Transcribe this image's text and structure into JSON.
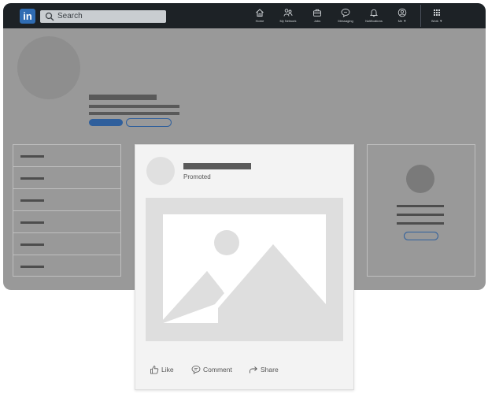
{
  "header": {
    "logo_text": "in",
    "search": {
      "placeholder": "Search"
    },
    "nav": [
      {
        "label": "Home",
        "icon": "home-icon"
      },
      {
        "label": "My Network",
        "icon": "network-icon"
      },
      {
        "label": "Jobs",
        "icon": "briefcase-icon"
      },
      {
        "label": "Messaging",
        "icon": "message-icon"
      },
      {
        "label": "Notifications",
        "icon": "bell-icon"
      },
      {
        "label": "Me",
        "icon": "user-icon"
      },
      {
        "label": "Work",
        "icon": "grid-icon"
      }
    ]
  },
  "post": {
    "promoted_label": "Promoted",
    "actions": [
      {
        "label": "Like",
        "icon": "like-icon"
      },
      {
        "label": "Comment",
        "icon": "comment-icon"
      },
      {
        "label": "Share",
        "icon": "share-icon"
      }
    ]
  },
  "colors": {
    "topbar": "#1d2226",
    "brand_blue": "#2f6cb3",
    "overlay_gray": "#999999",
    "card_bg": "#f3f3f3"
  }
}
